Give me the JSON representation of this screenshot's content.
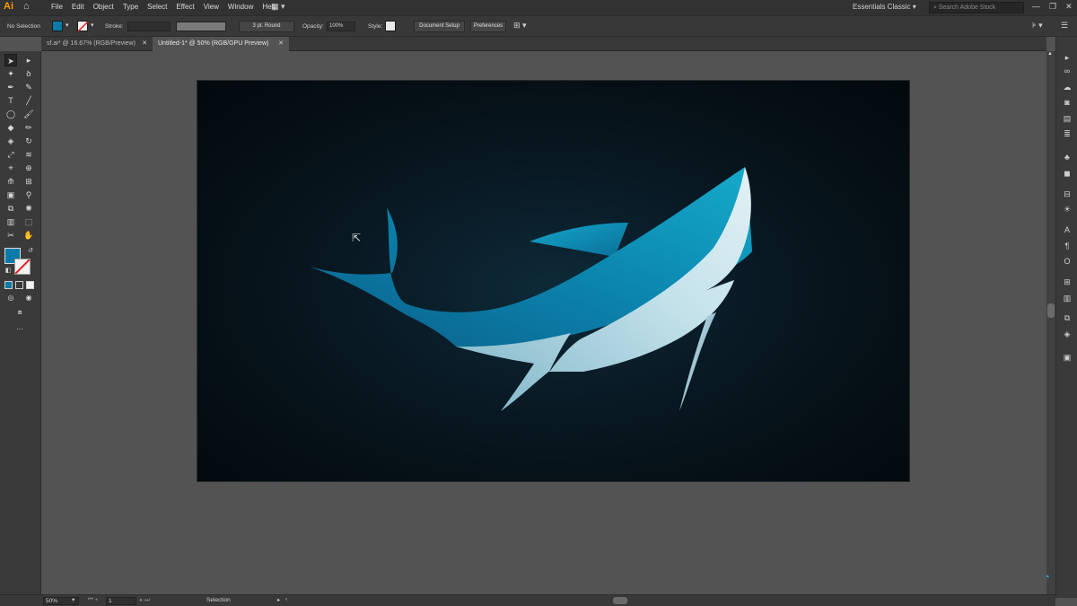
{
  "app": {
    "logo": "Ai"
  },
  "menu": {
    "items": [
      "File",
      "Edit",
      "Object",
      "Type",
      "Select",
      "Effect",
      "View",
      "Window",
      "Help"
    ]
  },
  "workspace": {
    "name": "Essentials Classic"
  },
  "search": {
    "placeholder": "Search Adobe Stock"
  },
  "control": {
    "selection_label": "No Selection",
    "stroke_label": "Stroke:",
    "brush": "3 pt. Round",
    "opacity_label": "Opacity:",
    "opacity_value": "100%",
    "style_label": "Style:",
    "document_setup": "Document Setup",
    "preferences": "Preferences"
  },
  "tabs": [
    {
      "label": "sf.ai* @ 16.67% (RGB/Preview)",
      "active": false
    },
    {
      "label": "Untitled-1* @ 50% (RGB/GPU Preview)",
      "active": true
    }
  ],
  "status": {
    "zoom": "50%",
    "artboard": "1",
    "tool": "Selection"
  },
  "colors": {
    "fill": "#0a7aa8",
    "shark_dark": "#0a6f9c",
    "shark_mid": "#109fc2",
    "shark_belly": "#c9e4ec",
    "background_dark": "#03090d",
    "background_light": "#0e2a38"
  },
  "icons": {
    "left_tools": [
      "selection-icon",
      "direct-selection-icon",
      "magic-wand-icon",
      "lasso-icon",
      "pen-icon",
      "curvature-icon",
      "type-icon",
      "line-icon",
      "ellipse-icon",
      "paintbrush-icon",
      "shaper-icon",
      "pencil-icon",
      "eraser-icon",
      "rotate-icon",
      "scale-icon",
      "warp-icon",
      "free-transform-icon",
      "shape-builder-icon",
      "perspective-icon",
      "mesh-icon",
      "gradient-icon",
      "eyedropper-icon",
      "blend-icon",
      "symbol-sprayer-icon",
      "graph-icon",
      "artboard-icon",
      "slice-icon",
      "hand-icon",
      "zoom-icon"
    ]
  }
}
